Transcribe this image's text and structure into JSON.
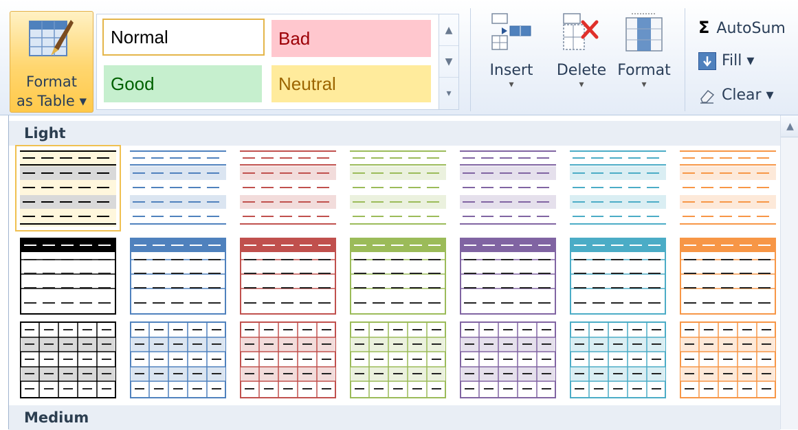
{
  "ribbon": {
    "format_as_table": {
      "line1": "Format",
      "line2": "as Table ▾"
    },
    "cell_styles": {
      "normal": "Normal",
      "bad": "Bad",
      "good": "Good",
      "neutral": "Neutral"
    },
    "cells": {
      "insert": "Insert",
      "delete": "Delete",
      "format": "Format",
      "dropdown": "▾"
    },
    "editing": {
      "autosum": "AutoSum",
      "fill": "Fill ▾",
      "clear": "Clear ▾",
      "sigma": "Σ"
    }
  },
  "gallery": {
    "sections": [
      "Light",
      "Medium"
    ],
    "selected_style": "light-black-1",
    "colors": [
      "#000000",
      "#4f81bd",
      "#c0504d",
      "#9bbb59",
      "#8064a2",
      "#4bacc6",
      "#f79646"
    ],
    "light_tints": [
      "#d9d9d9",
      "#dbe5f1",
      "#f2dcdb",
      "#ebf1de",
      "#e5e0ec",
      "#daeef3",
      "#fde9d9"
    ],
    "row_styles": [
      "light-banded",
      "light-header",
      "light-grid"
    ]
  }
}
